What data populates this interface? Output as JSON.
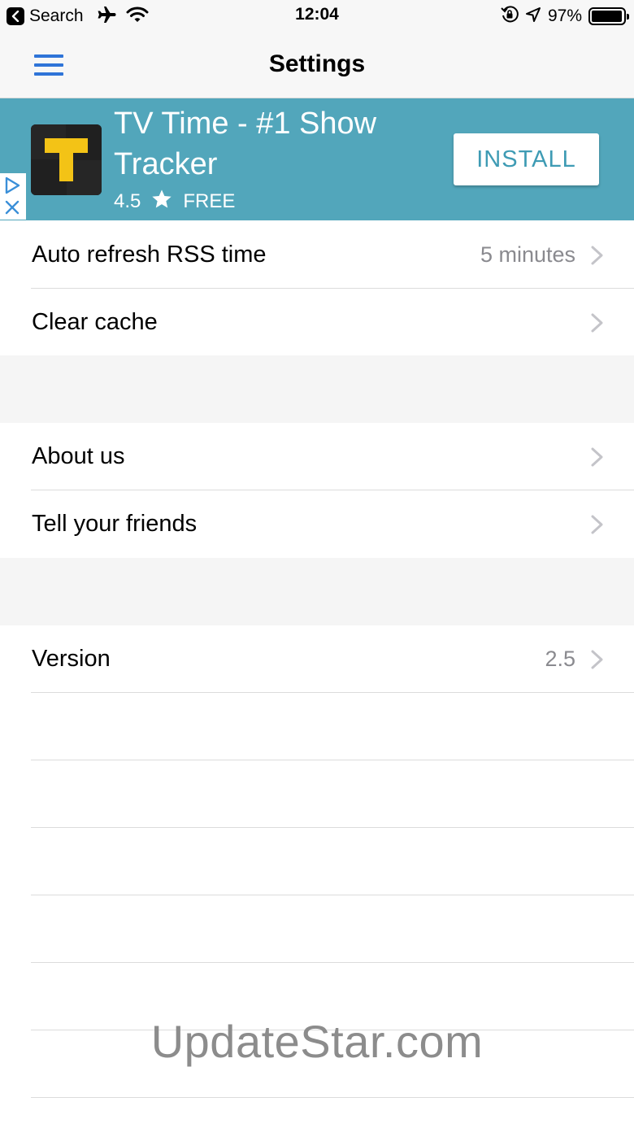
{
  "status_bar": {
    "back_app": "Search",
    "time": "12:04",
    "battery_text": "97%",
    "battery_level": 0.97,
    "icons": [
      "back-arrow-icon",
      "airplane-icon",
      "wifi-icon",
      "orientation-lock-icon",
      "location-icon",
      "battery-icon"
    ]
  },
  "nav": {
    "title": "Settings",
    "menu_icon": "hamburger-menu-icon",
    "accent": "#2f74d8"
  },
  "ad": {
    "title": "TV Time - #1 Show Tracker",
    "rating": "4.5",
    "price": "FREE",
    "install_label": "INSTALL",
    "background": "#52a6bb"
  },
  "settings": {
    "auto_refresh": {
      "label": "Auto refresh RSS time",
      "value": "5 minutes"
    },
    "clear_cache": {
      "label": "Clear cache"
    },
    "about_us": {
      "label": "About us"
    },
    "tell_friends": {
      "label": "Tell your friends"
    },
    "version": {
      "label": "Version",
      "value": "2.5"
    }
  },
  "watermark": "UpdateStar.com"
}
